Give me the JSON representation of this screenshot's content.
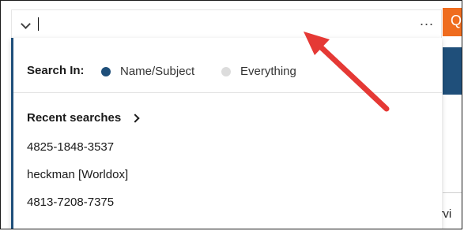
{
  "search": {
    "value": "",
    "placeholder": ""
  },
  "toolbar": {
    "more_label": "..."
  },
  "background": {
    "orange_glyph": "Q",
    "partial_text": "ervi",
    "accent_orange": "#ef6c1e",
    "accent_blue": "#1f4f7a"
  },
  "search_in": {
    "label": "Search In:",
    "options": [
      {
        "label": "Name/Subject",
        "selected": true
      },
      {
        "label": "Everything",
        "selected": false
      }
    ]
  },
  "recent": {
    "header": "Recent searches",
    "items": [
      "4825-1848-3537",
      "heckman [Worldox]",
      "4813-7208-7375"
    ]
  },
  "annotation": {
    "arrow_color": "#e53935",
    "arrow_icon": "red-pointer-arrow"
  }
}
